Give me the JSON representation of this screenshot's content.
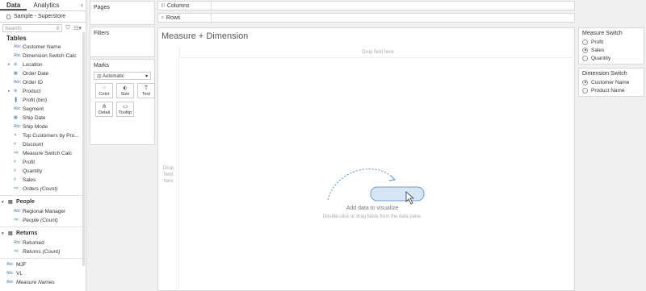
{
  "tabs": {
    "data": "Data",
    "analytics": "Analytics",
    "collapse": "‹"
  },
  "datasource": "Sample - Superstore",
  "search": {
    "placeholder": "Search"
  },
  "tables_title": "Tables",
  "fields": [
    {
      "type": "Abc",
      "name": "Customer Name",
      "measure": false,
      "caret": ""
    },
    {
      "type": "Abc",
      "name": "Dimension Switch Calc",
      "measure": false,
      "caret": ""
    },
    {
      "type": "⊞",
      "name": "Location",
      "measure": false,
      "caret": "▸"
    },
    {
      "type": "▦",
      "name": "Order Date",
      "measure": false,
      "caret": ""
    },
    {
      "type": "Abc",
      "name": "Order ID",
      "measure": false,
      "caret": ""
    },
    {
      "type": "⊞",
      "name": "Product",
      "measure": false,
      "caret": "▸"
    },
    {
      "type": "▐",
      "name": "Profit (bin)",
      "measure": false,
      "caret": ""
    },
    {
      "type": "Abc",
      "name": "Segment",
      "measure": false,
      "caret": ""
    },
    {
      "type": "▦",
      "name": "Ship Date",
      "measure": false,
      "caret": ""
    },
    {
      "type": "Abc",
      "name": "Ship Mode",
      "measure": false,
      "caret": ""
    },
    {
      "type": "⚭",
      "name": "Top Customers by Pro...",
      "measure": false,
      "caret": ""
    },
    {
      "type": "#",
      "name": "Discount",
      "measure": true,
      "caret": ""
    },
    {
      "type": "=#",
      "name": "Measure Switch Calc",
      "measure": true,
      "caret": ""
    },
    {
      "type": "#",
      "name": "Profit",
      "measure": true,
      "caret": ""
    },
    {
      "type": "#",
      "name": "Quantity",
      "measure": true,
      "caret": ""
    },
    {
      "type": "#",
      "name": "Sales",
      "measure": true,
      "caret": ""
    },
    {
      "type": "=#",
      "name": "Orders (Count)",
      "measure": true,
      "caret": "",
      "italic": true
    }
  ],
  "people": {
    "title": "People",
    "fields": [
      {
        "type": "Abc",
        "name": "Regional Manager"
      },
      {
        "type": "=#",
        "name": "People (Count)",
        "italic": true
      }
    ]
  },
  "returns": {
    "title": "Returns",
    "fields": [
      {
        "type": "Abc",
        "name": "Returned"
      },
      {
        "type": "=#",
        "name": "Returns (Count)",
        "italic": true
      }
    ]
  },
  "params": [
    {
      "type": "Abc",
      "name": "MJF"
    },
    {
      "type": "Abc",
      "name": "VL"
    },
    {
      "type": "Abc",
      "name": "Measure Names",
      "italic": true
    }
  ],
  "shelves": {
    "pages": "Pages",
    "filters": "Filters",
    "marks": "Marks",
    "marks_type": "Automatic",
    "columns": "Columns",
    "rows": "Rows"
  },
  "mark_buttons": [
    {
      "icon": "⁘",
      "label": "Color"
    },
    {
      "icon": "⬖",
      "label": "Size"
    },
    {
      "icon": "T",
      "label": "Text"
    },
    {
      "icon": "⋔",
      "label": "Detail"
    },
    {
      "icon": "▭",
      "label": "Tooltip"
    }
  ],
  "view": {
    "title": "Measure + Dimension",
    "drop_top": "Drop field here",
    "drop_left": "Drop field here",
    "add_title": "Add data to visualize",
    "add_sub": "Double-click or drag fields from the data pane."
  },
  "measure_switch": {
    "title": "Measure Switch",
    "options": [
      {
        "label": "Profit",
        "selected": false
      },
      {
        "label": "Sales",
        "selected": true
      },
      {
        "label": "Quantity",
        "selected": false
      }
    ]
  },
  "dimension_switch": {
    "title": "Dimension Switch",
    "options": [
      {
        "label": "Customer Name",
        "selected": true
      },
      {
        "label": "Product Name",
        "selected": false
      }
    ]
  },
  "colors": {
    "accent": "#4a7fb0",
    "measure": "#3a9c7a",
    "pill_fill": "#d6e6f5",
    "pill_border": "#6ea0cc"
  }
}
